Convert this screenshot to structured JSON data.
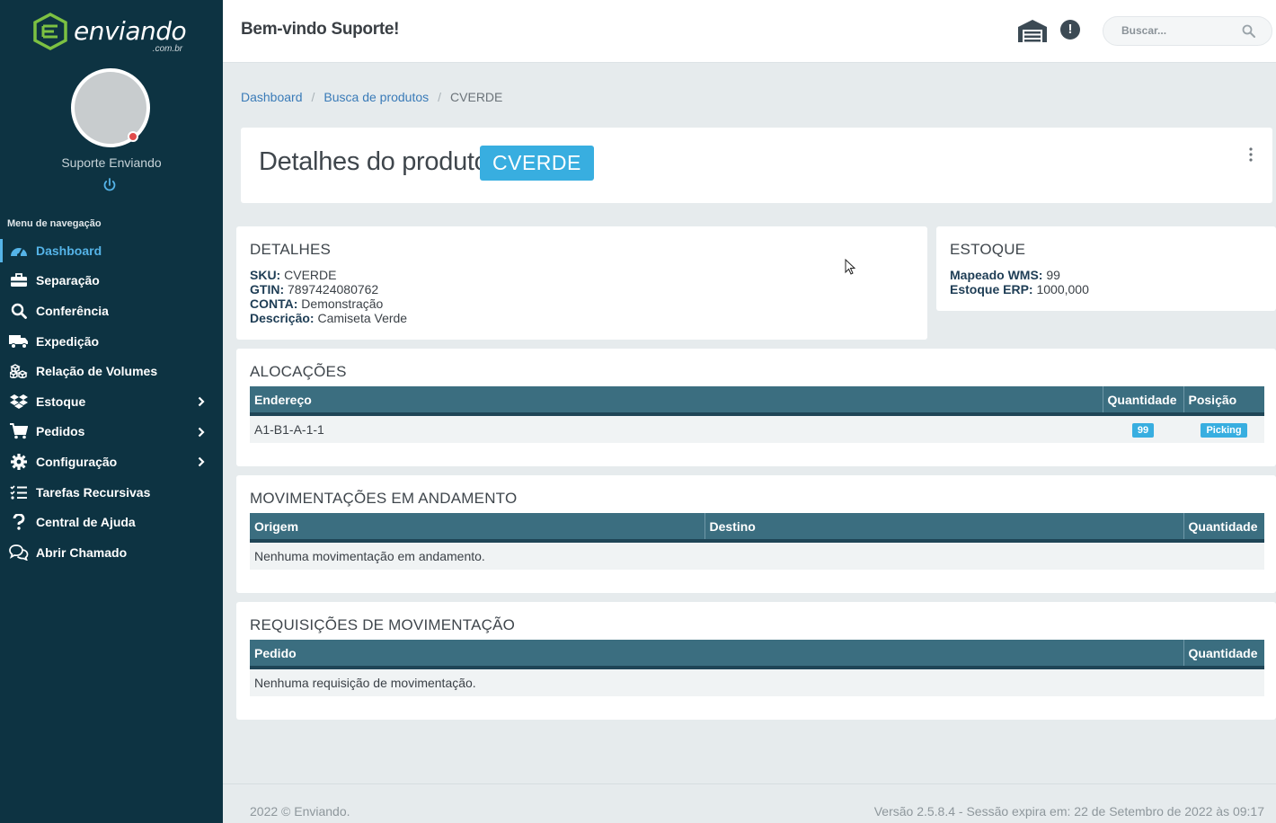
{
  "brand": {
    "name": "enviando",
    "suffix": ".com.br",
    "color": "#7cc142"
  },
  "user": {
    "name": "Suporte Enviando",
    "status_color": "#e04b4b"
  },
  "nav": {
    "title": "Menu de navegação",
    "items": [
      {
        "label": "Dashboard",
        "icon": "dashboard-icon",
        "active": true
      },
      {
        "label": "Separação",
        "icon": "toolbox-icon"
      },
      {
        "label": "Conferência",
        "icon": "search-icon"
      },
      {
        "label": "Expedição",
        "icon": "truck-icon"
      },
      {
        "label": "Relação de Volumes",
        "icon": "boxes-icon"
      },
      {
        "label": "Estoque",
        "icon": "dropbox-icon",
        "has_children": true
      },
      {
        "label": "Pedidos",
        "icon": "cart-icon",
        "has_children": true
      },
      {
        "label": "Configuração",
        "icon": "gear-icon",
        "has_children": true
      },
      {
        "label": "Tarefas Recursivas",
        "icon": "tasks-icon"
      },
      {
        "label": "Central de Ajuda",
        "icon": "question-icon"
      },
      {
        "label": "Abrir Chamado",
        "icon": "chat-icon"
      }
    ]
  },
  "header": {
    "welcome": "Bem-vindo Suporte!",
    "search_placeholder": "Buscar..."
  },
  "breadcrumb": [
    "Dashboard",
    "Busca de produtos",
    "CVERDE"
  ],
  "product": {
    "title": "Detalhes do produto",
    "badge": "CVERDE",
    "accent": "#38aee0"
  },
  "details": {
    "title": "DETALHES",
    "rows": [
      {
        "key": "SKU:",
        "value": "CVERDE"
      },
      {
        "key": "GTIN:",
        "value": "7897424080762"
      },
      {
        "key": "CONTA:",
        "value": "Demonstração"
      },
      {
        "key": "Descrição:",
        "value": "Camiseta Verde"
      }
    ]
  },
  "stock": {
    "title": "ESTOQUE",
    "rows": [
      {
        "key": "Mapeado WMS:",
        "value": "99"
      },
      {
        "key": "Estoque ERP:",
        "value": "1000,000"
      }
    ]
  },
  "allocations": {
    "title": "ALOCAÇÕES",
    "columns": [
      "Endereço",
      "Quantidade",
      "Posição"
    ],
    "rows": [
      {
        "address": "A1-B1-A-1-1",
        "quantity": "99",
        "position": "Picking"
      }
    ]
  },
  "movements": {
    "title": "MOVIMENTAÇÕES EM ANDAMENTO",
    "columns": [
      "Origem",
      "Destino",
      "Quantidade"
    ],
    "empty": "Nenhuma movimentação em andamento."
  },
  "requests": {
    "title": "REQUISIÇÕES DE MOVIMENTAÇÃO",
    "columns": [
      "Pedido",
      "Quantidade"
    ],
    "empty": "Nenhuma requisição de movimentação."
  },
  "footer": {
    "left": "2022 © Enviando.",
    "right": "Versão 2.5.8.4 - Sessão expira em: 22 de Setembro de 2022 às 09:17"
  },
  "colors": {
    "sidebar": "#0d3342",
    "table_header": "#3b6e80",
    "link": "#3a7bb8"
  }
}
